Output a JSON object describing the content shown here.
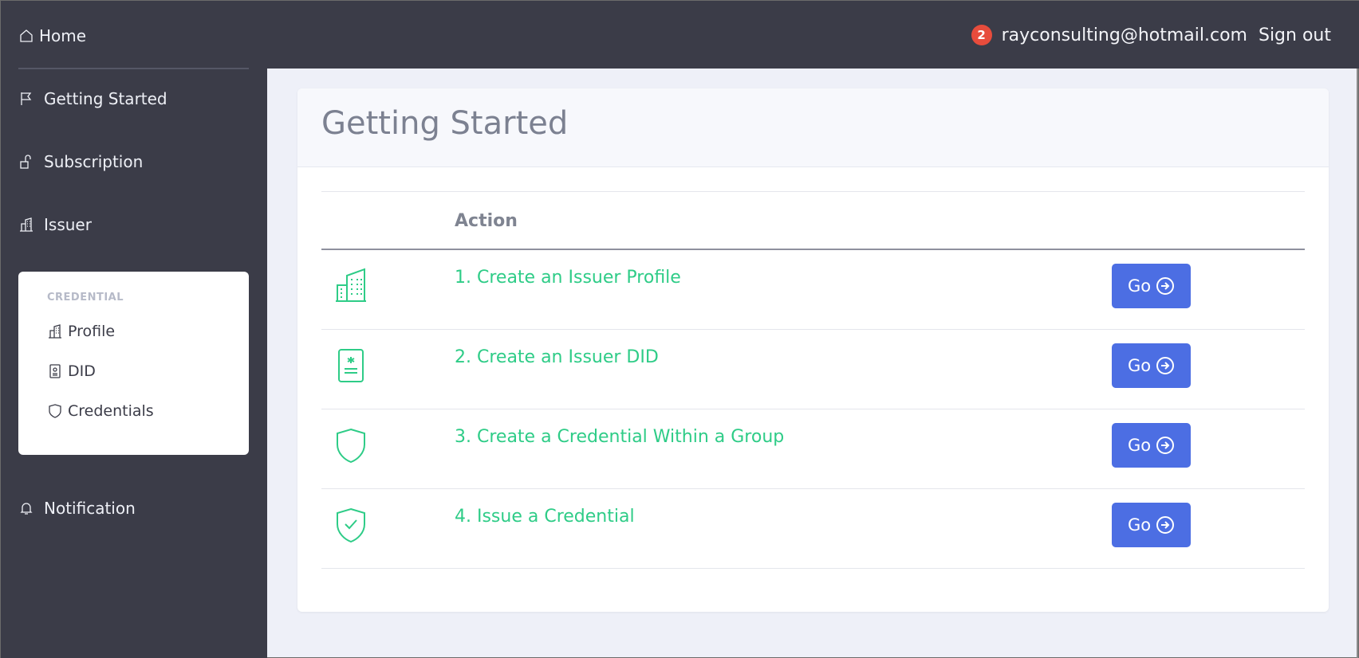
{
  "topbar": {
    "home_label": "Home",
    "notification_count": "2",
    "user_email": "rayconsulting@hotmail.com",
    "sign_out_label": "Sign out"
  },
  "sidebar": {
    "items": [
      {
        "label": "Getting Started",
        "icon": "flag-icon"
      },
      {
        "label": "Subscription",
        "icon": "unlock-icon"
      },
      {
        "label": "Issuer",
        "icon": "building-icon"
      },
      {
        "label": "Notification",
        "icon": "bell-icon"
      }
    ],
    "submenu": {
      "title": "CREDENTIAL",
      "items": [
        {
          "label": "Profile",
          "icon": "building-icon"
        },
        {
          "label": "DID",
          "icon": "id-card-icon"
        },
        {
          "label": "Credentials",
          "icon": "shield-icon"
        }
      ]
    }
  },
  "main": {
    "title": "Getting Started",
    "table": {
      "header_action": "Action",
      "rows": [
        {
          "text": "1. Create an Issuer Profile",
          "button": "Go",
          "icon": "building-icon"
        },
        {
          "text": "2. Create an Issuer DID",
          "button": "Go",
          "icon": "id-card-icon"
        },
        {
          "text": "3. Create a Credential Within a Group",
          "button": "Go",
          "icon": "shield-icon"
        },
        {
          "text": "4. Issue a Credential",
          "button": "Go",
          "icon": "shield-check-icon"
        }
      ]
    }
  },
  "colors": {
    "sidebar_bg": "#3b3c48",
    "accent_green": "#2ecc87",
    "button_blue": "#4c6ee3",
    "badge_red": "#e74c3c"
  }
}
